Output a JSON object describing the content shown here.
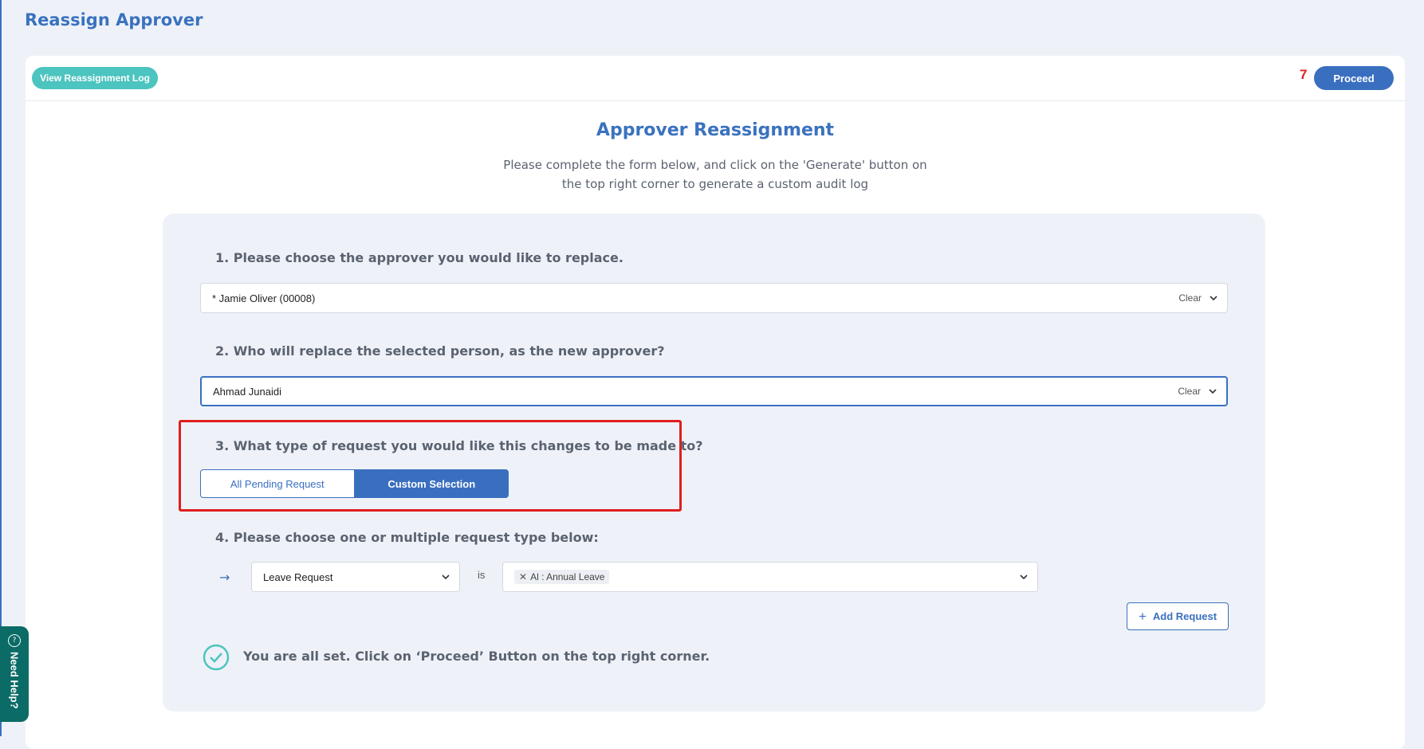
{
  "page": {
    "title": "Reassign Approver"
  },
  "toolbar": {
    "log_label": "View Reassignment Log",
    "badge": "7",
    "proceed_label": "Proceed"
  },
  "section": {
    "title": "Approver Reassignment",
    "description": "Please complete the form below, and click on the 'Generate' button on the top right corner to generate a custom audit log"
  },
  "questions": {
    "q1": {
      "label": "1. Please choose the approver you would like to replace.",
      "value": "* Jamie Oliver (00008)",
      "clear": "Clear"
    },
    "q2": {
      "label": "2. Who will replace the selected person, as the new approver?",
      "value": "Ahmad Junaidi",
      "clear": "Clear"
    },
    "q3": {
      "label": "3. What type of request you would like this changes to be made to?",
      "options": [
        "All Pending Request",
        "Custom Selection"
      ],
      "selected": "Custom Selection"
    },
    "q4": {
      "label": "4. Please choose one or multiple request type below:",
      "request_type": "Leave Request",
      "connector": "is",
      "tags": [
        "Al : Annual Leave"
      ],
      "add_label": "Add Request"
    }
  },
  "completion": {
    "message": "You are all set. Click on ‘Proceed’ Button on the top right corner."
  },
  "help": {
    "label": "Need Help?"
  },
  "colors": {
    "accent": "#3a6fc0",
    "teal": "#4cc4bf",
    "highlight": "#e01e1e",
    "help_bg": "#0b6b66"
  },
  "icons": {
    "arrow": "arrow-right-icon",
    "check": "check-circle-icon",
    "help": "help-circle-icon"
  }
}
